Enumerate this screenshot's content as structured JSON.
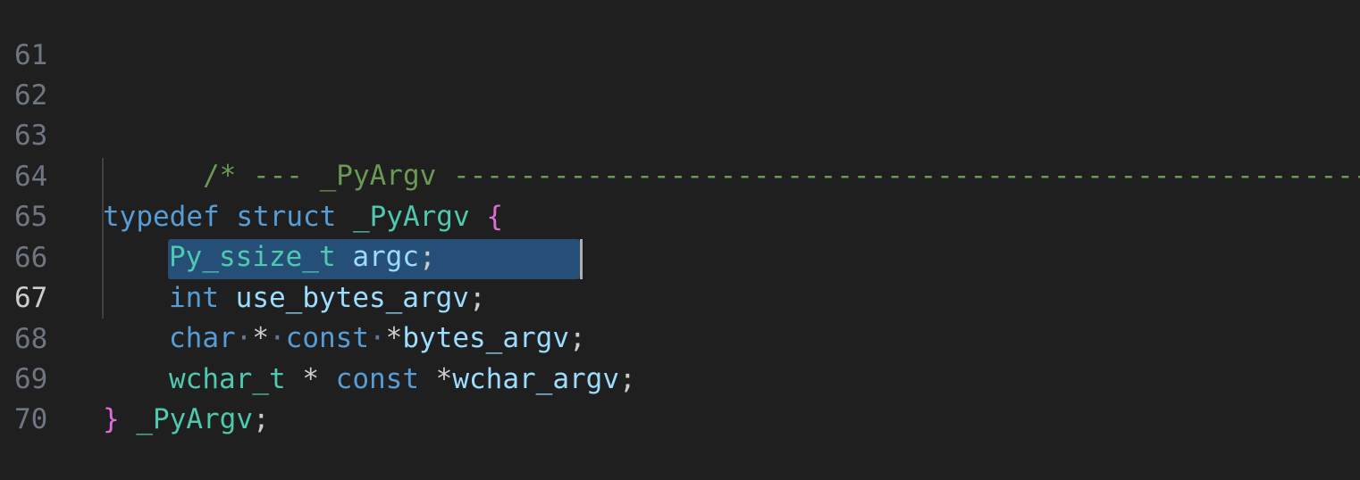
{
  "editor": {
    "lines": [
      {
        "number": "61",
        "text": ""
      },
      {
        "number": "62",
        "comment": "/* --- _PyArgv ------------------------------------------------------- */"
      },
      {
        "number": "63",
        "text": ""
      },
      {
        "number": "64",
        "kw1": "typedef",
        "kw2": "struct",
        "name": "_PyArgv",
        "brace": "{"
      },
      {
        "number": "65",
        "type": "Py_ssize_t",
        "var": "argc",
        "semi": ";"
      },
      {
        "number": "66",
        "kw": "int",
        "var": "use_bytes_argv",
        "semi": ";"
      },
      {
        "number": "67",
        "kw": "char",
        "ws1": "·",
        "star": "*",
        "ws2": "·",
        "kw2": "const",
        "ws3": "·",
        "star2": "*",
        "var": "bytes_argv",
        "semi": ";"
      },
      {
        "number": "68",
        "type": "wchar_t",
        "star": "*",
        "kw2": "const",
        "star2": "*",
        "var": "wchar_argv",
        "semi": ";"
      },
      {
        "number": "69",
        "brace": "}",
        "name": "_PyArgv",
        "semi": ";"
      },
      {
        "number": "70",
        "text": ""
      }
    ]
  }
}
